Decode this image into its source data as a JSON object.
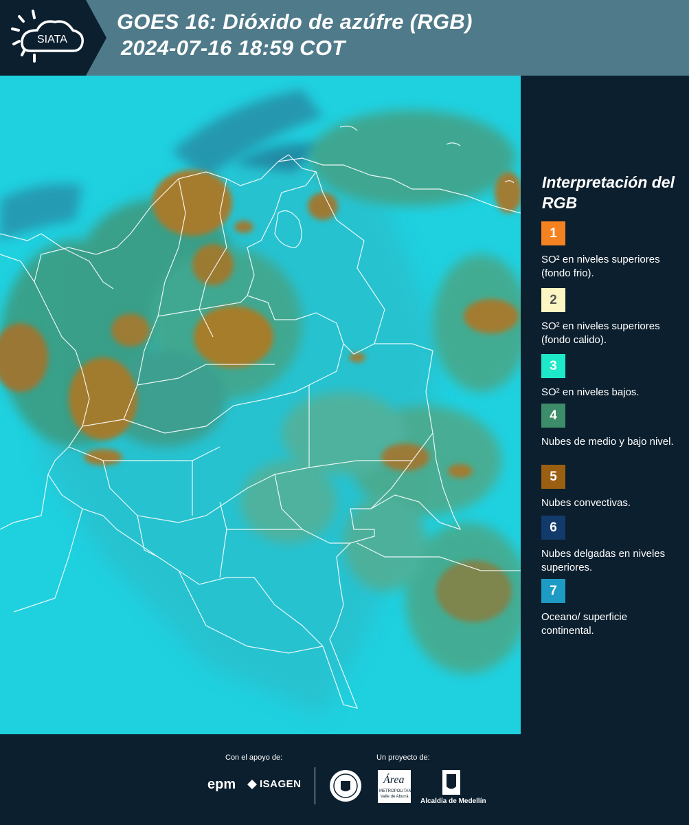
{
  "header": {
    "logo_text": "SIATA",
    "title_line1": "GOES 16: Dióxido de azúfre (RGB)",
    "title_line2": "2024-07-16 18:59 COT"
  },
  "map": {
    "ocean_color": "#1ed2e0",
    "land_color": "#2fb7c8",
    "green_cloud_color": "#3f9b80",
    "convective_cloud_color": "#a67d2c",
    "border_color": "#ffffff"
  },
  "legend": {
    "title": "Interpretación del RGB",
    "items": [
      {
        "number": "1",
        "label": "SO² en niveles superiores (fondo frio).",
        "color": "#f58220",
        "text_color": "#ffffff"
      },
      {
        "number": "2",
        "label": "SO² en niveles superiores (fondo calido).",
        "color": "#fdf5c2",
        "text_color": "#555555"
      },
      {
        "number": "3",
        "label": "SO² en niveles bajos.",
        "color": "#1de8c8",
        "text_color": "#ffffff"
      },
      {
        "number": "4",
        "label": "Nubes de medio y bajo nivel.",
        "color": "#3d8c6a",
        "text_color": "#ffffff"
      },
      {
        "number": "5",
        "label": "Nubes convectivas.",
        "color": "#9a5f10",
        "text_color": "#ffffff"
      },
      {
        "number": "6",
        "label": "Nubes delgadas en niveles superiores.",
        "color": "#123a6a",
        "text_color": "#ffffff"
      },
      {
        "number": "7",
        "label": "Oceano/ superficie continental.",
        "color": "#1e9bc4",
        "text_color": "#ffffff"
      }
    ]
  },
  "footer": {
    "support_caption": "Con el apoyo de:",
    "project_caption": "Un proyecto de:",
    "sponsor_epm": "epm",
    "sponsor_isagen": "ISAGEN",
    "partner_area": "Área",
    "partner_area_sub1": "METROPOLITANA",
    "partner_area_sub2": "Valle de Aburrá",
    "partner_alcaldia": "Alcaldía de Medellín"
  }
}
